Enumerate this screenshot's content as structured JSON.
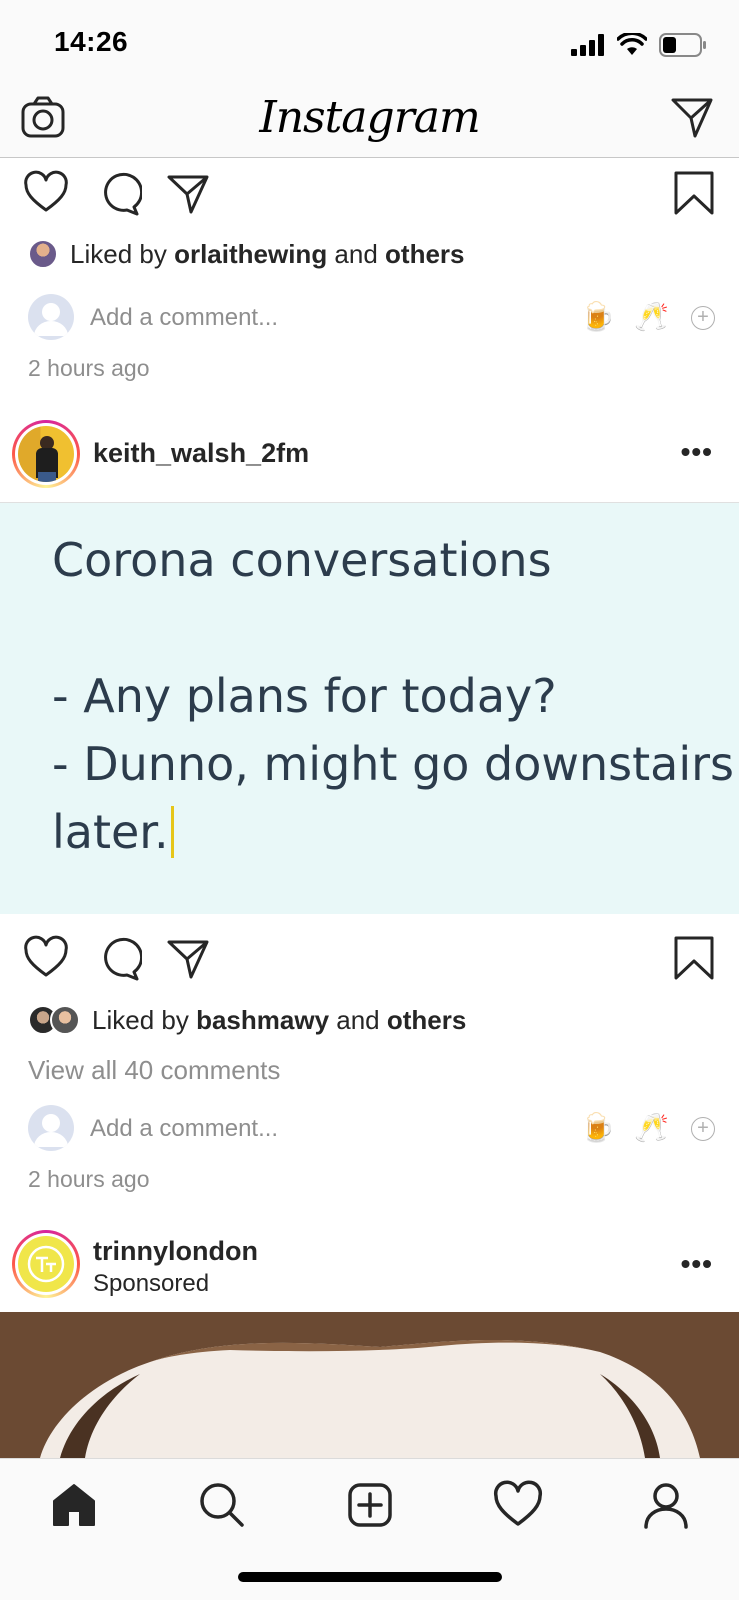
{
  "status_bar": {
    "time": "14:26"
  },
  "nav": {
    "logo": "Instagram"
  },
  "post1": {
    "liked_by_prefix": "Liked by ",
    "liked_by_user": "orlaithewing",
    "liked_by_and": " and ",
    "liked_by_others": "others",
    "comment_placeholder": "Add a comment...",
    "time_ago": "2 hours ago"
  },
  "post2": {
    "username": "keith_walsh_2fm",
    "more": "•••",
    "text_lines": [
      "Corona conversations",
      "- Any plans for today?",
      "- Dunno, might go downstairs",
      "later."
    ],
    "liked_by_prefix": "Liked by ",
    "liked_by_user": "bashmawy",
    "liked_by_and": " and ",
    "liked_by_others": "others",
    "view_comments": "View all 40 comments",
    "comment_placeholder": "Add a comment...",
    "time_ago": "2 hours ago"
  },
  "post3": {
    "username": "trinnylondon",
    "sponsored": "Sponsored",
    "more": "•••"
  },
  "quick_emojis": [
    "🍺",
    "🥂"
  ],
  "colors": {
    "accent_text": "#262626",
    "muted": "#8e8e8e",
    "text_post_bg": "#e9f8f8"
  }
}
